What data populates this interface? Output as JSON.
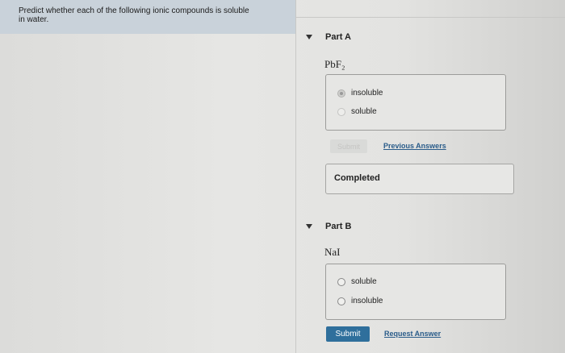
{
  "prompt": {
    "line1": "Predict whether each of the following ionic compounds is soluble",
    "line2": "in water."
  },
  "partA": {
    "title": "Part A",
    "compound": "PbF₂",
    "options": [
      {
        "label": "insoluble",
        "selected": true
      },
      {
        "label": "soluble",
        "selected": false
      }
    ],
    "submit_label": "Submit",
    "previous_answers_label": "Previous Answers",
    "completed_label": "Completed"
  },
  "partB": {
    "title": "Part B",
    "compound": "NaI",
    "options": [
      {
        "label": "soluble",
        "selected": false
      },
      {
        "label": "insoluble",
        "selected": false
      }
    ],
    "submit_label": "Submit",
    "request_answer_label": "Request Answer"
  },
  "colors": {
    "prompt_bg": "#c9d2da",
    "submit_button": "#2f6f9c",
    "link": "#2a5c8a"
  }
}
